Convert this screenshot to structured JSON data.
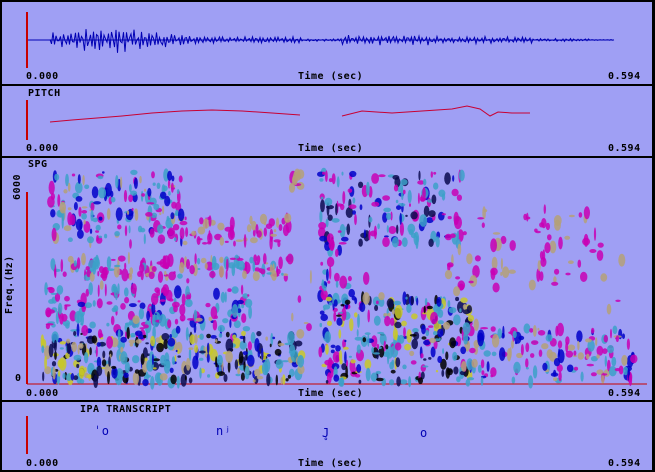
{
  "waveform": {
    "time_start": "0.000",
    "time_end": "0.594",
    "axis_label": "Time (sec)"
  },
  "pitch": {
    "title": "PITCH",
    "time_start": "0.000",
    "time_end": "0.594",
    "axis_label": "Time (sec)"
  },
  "spectrogram": {
    "title": "SPG",
    "y_label": "Freq.(Hz)",
    "y_max": "6000",
    "y_min": "0",
    "time_start": "0.000",
    "time_end": "0.594",
    "axis_label": "Time (sec)"
  },
  "ipa": {
    "title": "IPA TRANSCRIPT",
    "symbols": [
      "ˈo",
      "nʲ",
      "J̥",
      "o"
    ],
    "time_start": "0.000",
    "time_end": "0.594",
    "axis_label": "Time (sec)"
  },
  "colors": {
    "panel_bg": "#9f9ff4",
    "waveform": "#0000b4",
    "pitch": "#c80032",
    "marker": "#c80000"
  }
}
